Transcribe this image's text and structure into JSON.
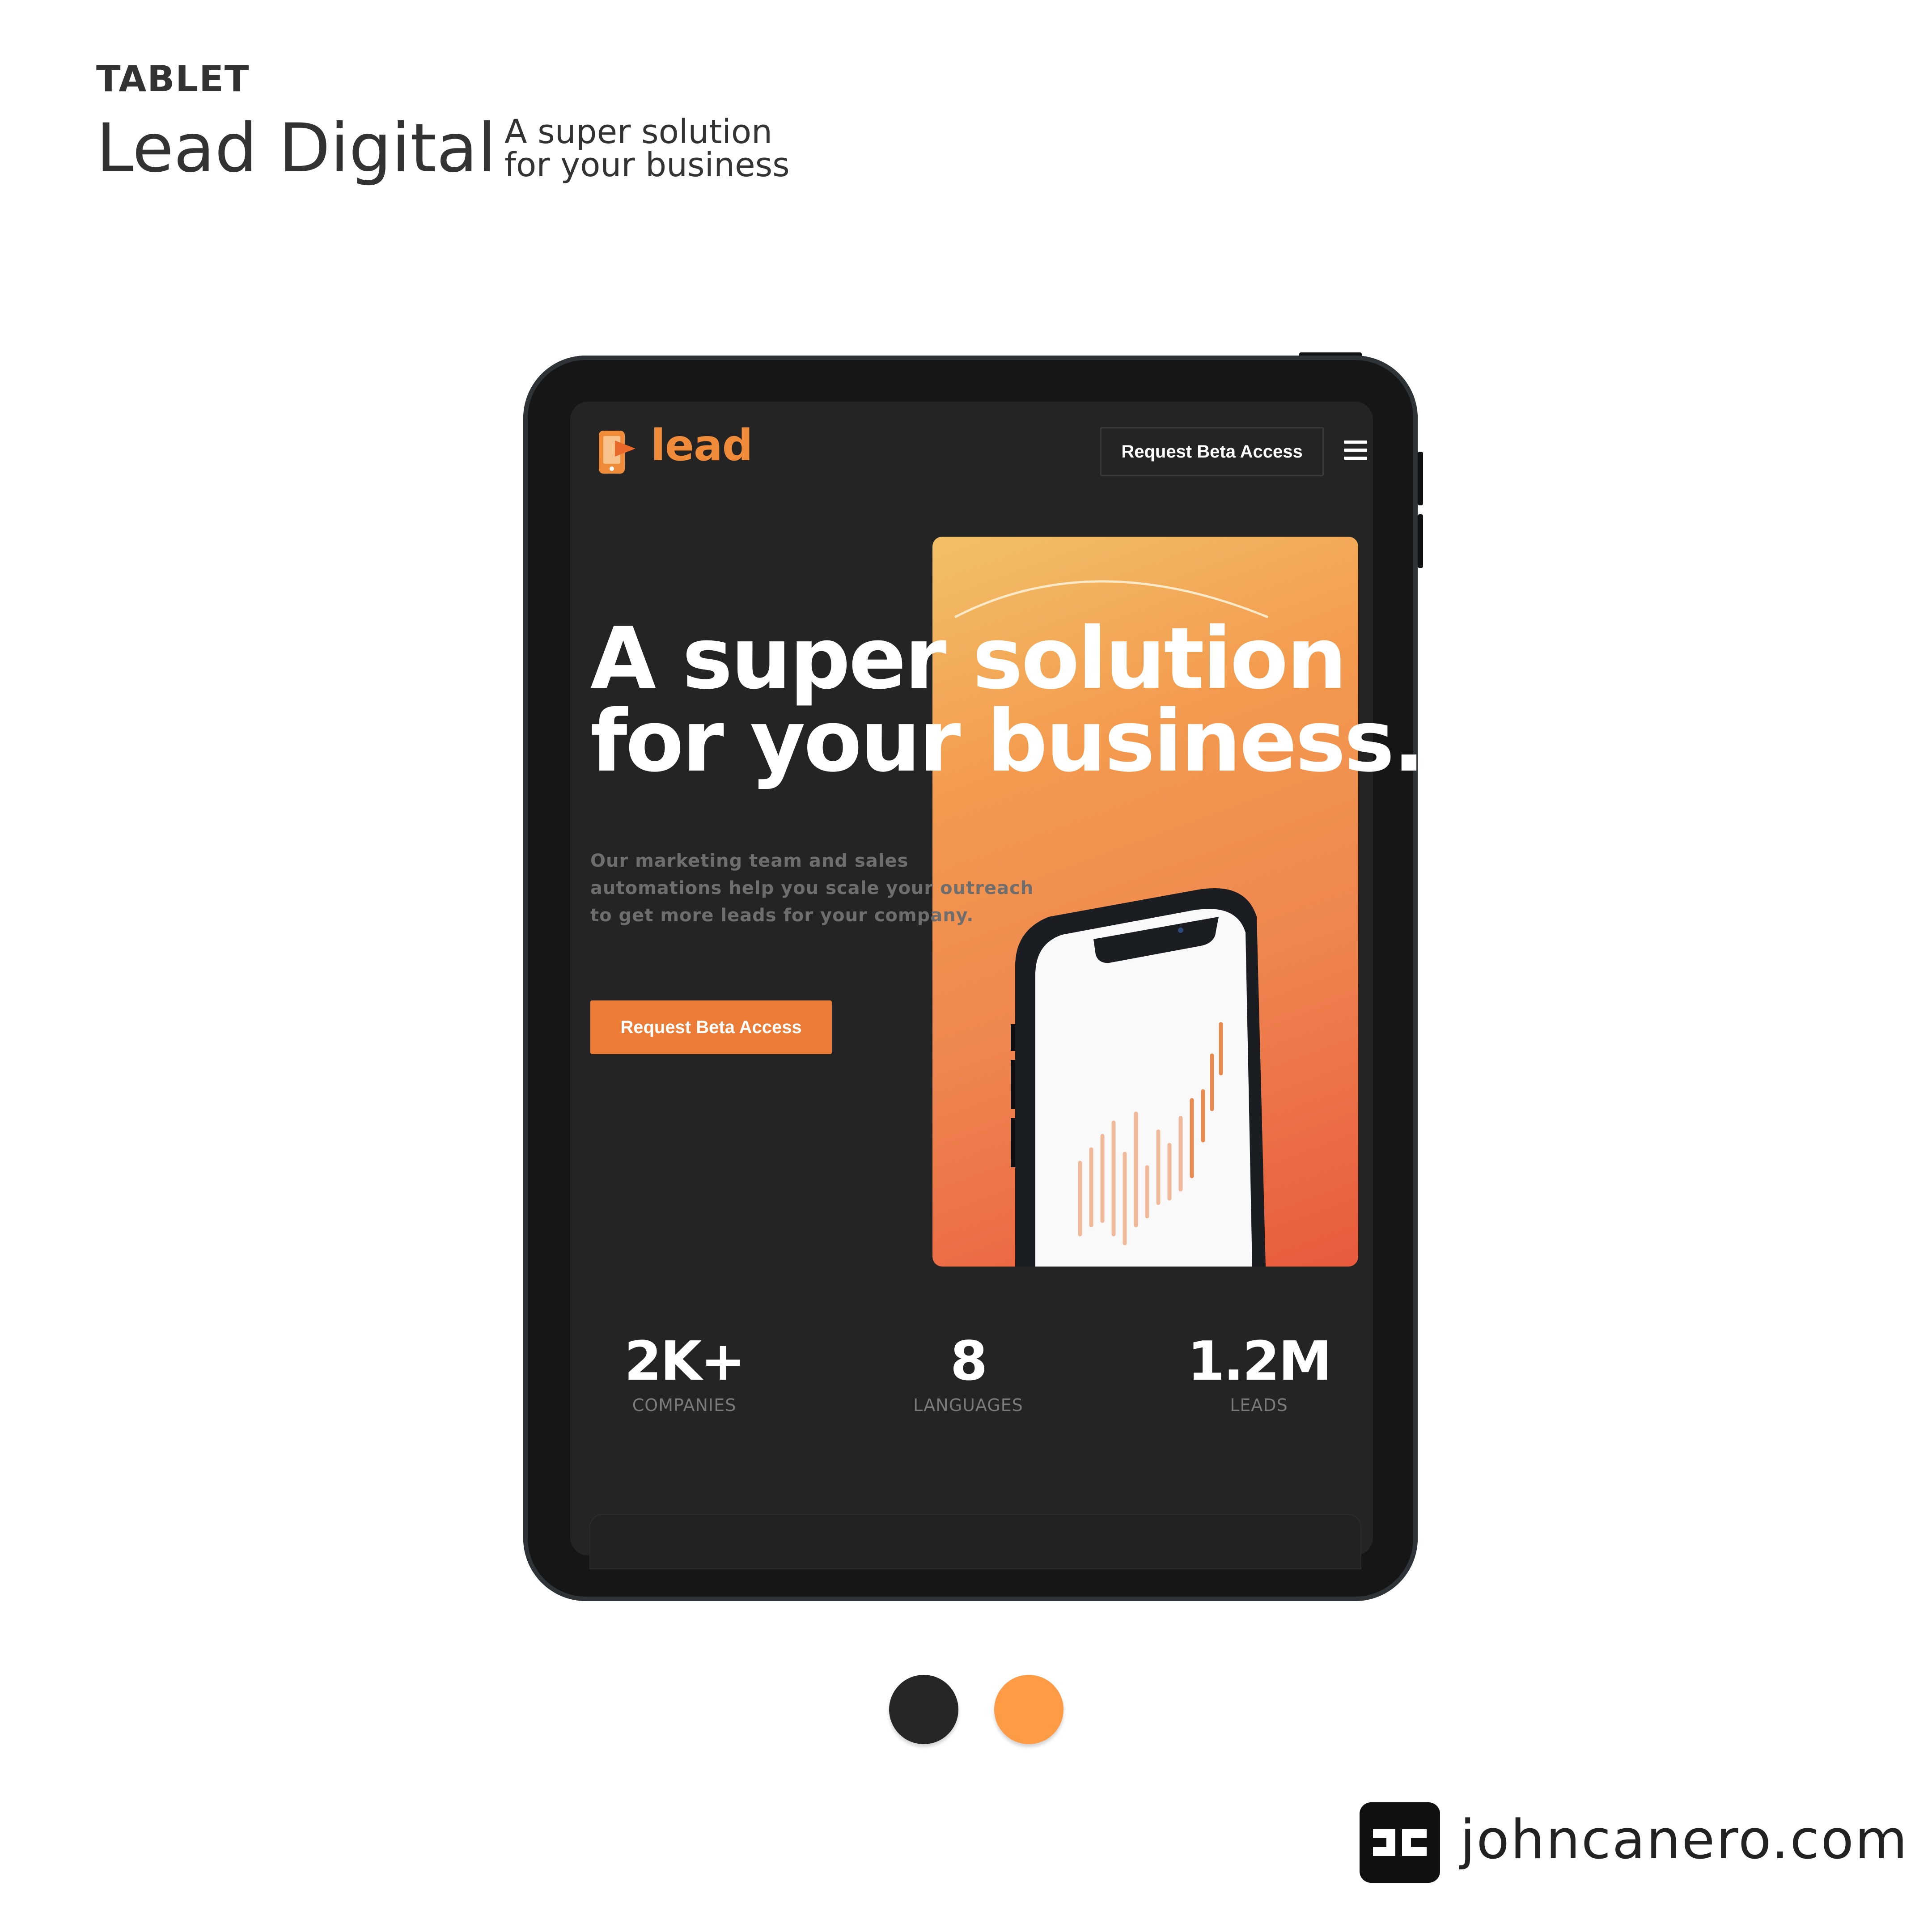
{
  "showcase": {
    "device_label": "TABLET",
    "project_title": "Lead Digital",
    "tagline_line1": "A super solution",
    "tagline_line2": "for your business"
  },
  "nav": {
    "logo_text": "lead",
    "cta_label": "Request Beta Access",
    "menu_icon": "hamburger-menu-icon"
  },
  "hero": {
    "headline_line1": "A super solution",
    "headline_line2": "for your business.",
    "description": "Our marketing team and sales automations help you scale your outreach to get more leads for your company.",
    "cta_label": "Request Beta Access"
  },
  "stats": [
    {
      "value": "2K+",
      "label": "COMPANIES"
    },
    {
      "value": "8",
      "label": "LANGUAGES"
    },
    {
      "value": "1.2M",
      "label": "LEADS"
    }
  ],
  "palette": [
    "#262626",
    "#ff9b44"
  ],
  "brand": {
    "logo_icon": "jc-logo-icon",
    "site": "johncanero.com"
  },
  "colors": {
    "accent": "#eb7b35",
    "screen_bg": "#242424",
    "frame": "#161616"
  }
}
